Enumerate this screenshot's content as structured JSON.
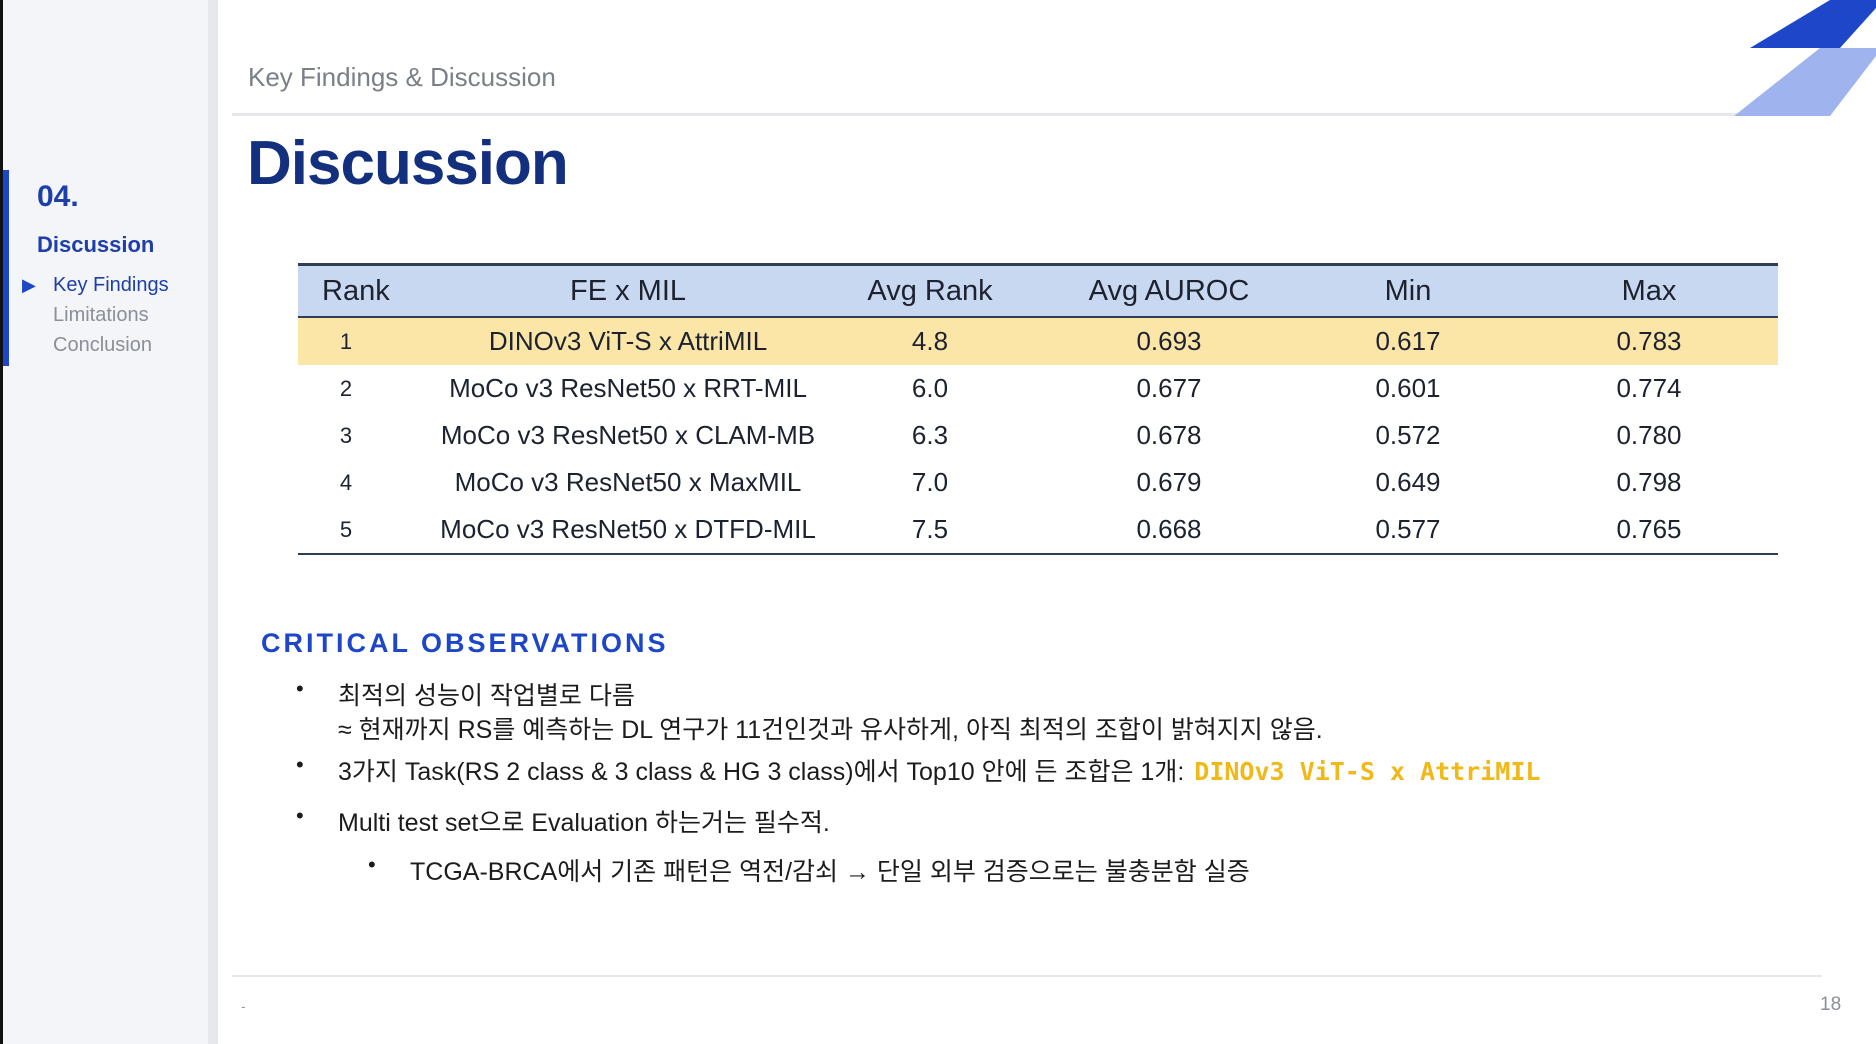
{
  "sidebar": {
    "section_number": "04.",
    "section_name": "Discussion",
    "nav": [
      {
        "label": "Key Findings",
        "active": true
      },
      {
        "label": "Limitations",
        "active": false
      },
      {
        "label": "Conclusion",
        "active": false
      }
    ]
  },
  "header": {
    "breadcrumb": "Key Findings & Discussion"
  },
  "page_title": "Discussion",
  "table": {
    "headers": [
      "Rank",
      "FE x MIL",
      "Avg Rank",
      "Avg AUROC",
      "Min",
      "Max"
    ],
    "rows": [
      {
        "rank": "1",
        "model": "DINOv3 ViT-S x AttriMIL",
        "avg_rank": "4.8",
        "avg_auroc": "0.693",
        "min": "0.617",
        "max": "0.783",
        "highlight": true
      },
      {
        "rank": "2",
        "model": "MoCo v3 ResNet50 x RRT-MIL",
        "avg_rank": "6.0",
        "avg_auroc": "0.677",
        "min": "0.601",
        "max": "0.774"
      },
      {
        "rank": "3",
        "model": "MoCo v3 ResNet50 x CLAM-MB",
        "avg_rank": "6.3",
        "avg_auroc": "0.678",
        "min": "0.572",
        "max": "0.780"
      },
      {
        "rank": "4",
        "model": "MoCo v3 ResNet50 x MaxMIL",
        "avg_rank": "7.0",
        "avg_auroc": "0.679",
        "min": "0.649",
        "max": "0.798"
      },
      {
        "rank": "5",
        "model": "MoCo v3 ResNet50 x DTFD-MIL",
        "avg_rank": "7.5",
        "avg_auroc": "0.668",
        "min": "0.577",
        "max": "0.765"
      }
    ]
  },
  "observations": {
    "title": "CRITICAL OBSERVATIONS",
    "bullet_glyph": "•",
    "b1_line1": "최적의 성능이 작업별로 다름",
    "b1_line2": "≈ 현재까지 RS를 예측하는 DL 연구가 11건인것과 유사하게, 아직 최적의 조합이 밝혀지지 않음.",
    "b2_text": "3가지 Task(RS 2 class & 3 class & HG 3 class)에서 Top10 안에 든 조합은 1개:",
    "b2_highlight": "DINOv3 ViT-S x AttriMIL",
    "b3_text": "Multi test set으로 Evaluation 하는거는 필수적.",
    "b4_text": "TCGA-BRCA에서 기존 패턴은 역전/감쇠 → 단일 외부 검증으로는 불충분함 실증"
  },
  "footer": {
    "left_mark": "-",
    "page_number": "18"
  },
  "colors": {
    "accent_blue": "#1d46c8",
    "title_navy": "#13307e",
    "highlight_row": "#fbe6a7",
    "header_row": "#c9d8f1",
    "highlight_text": "#f1b81a"
  }
}
